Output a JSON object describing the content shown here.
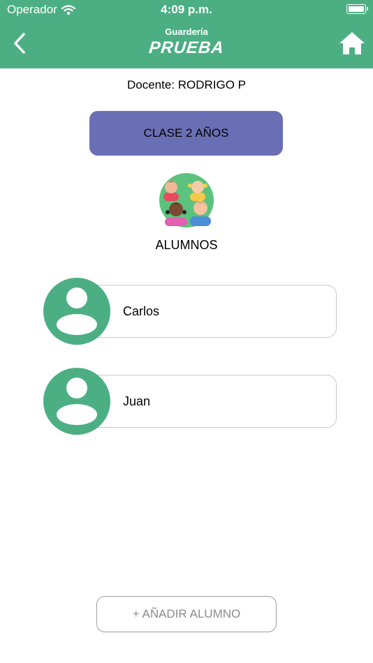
{
  "status_bar": {
    "carrier": "Operador",
    "time": "4:09 p.m."
  },
  "header": {
    "brand_top": "Guardería",
    "brand_main": "PRUEBA"
  },
  "teacher_label": "Docente: RODRIGO P",
  "class_button_label": "CLASE 2 AÑOS",
  "section_title": "ALUMNOS",
  "students": [
    {
      "name": "Carlos"
    },
    {
      "name": "Juan"
    }
  ],
  "add_button_label": "+ AÑADIR ALUMNO",
  "colors": {
    "primary": "#4caf84",
    "class_button": "#6a6fb5",
    "card_border": "#c8c8c8",
    "add_button_text": "#8c8c8c"
  },
  "icons": {
    "back": "chevron-left-icon",
    "home": "home-icon",
    "wifi": "wifi-icon",
    "battery": "battery-icon",
    "kids": "kids-group-icon",
    "avatar": "user-avatar-icon"
  }
}
